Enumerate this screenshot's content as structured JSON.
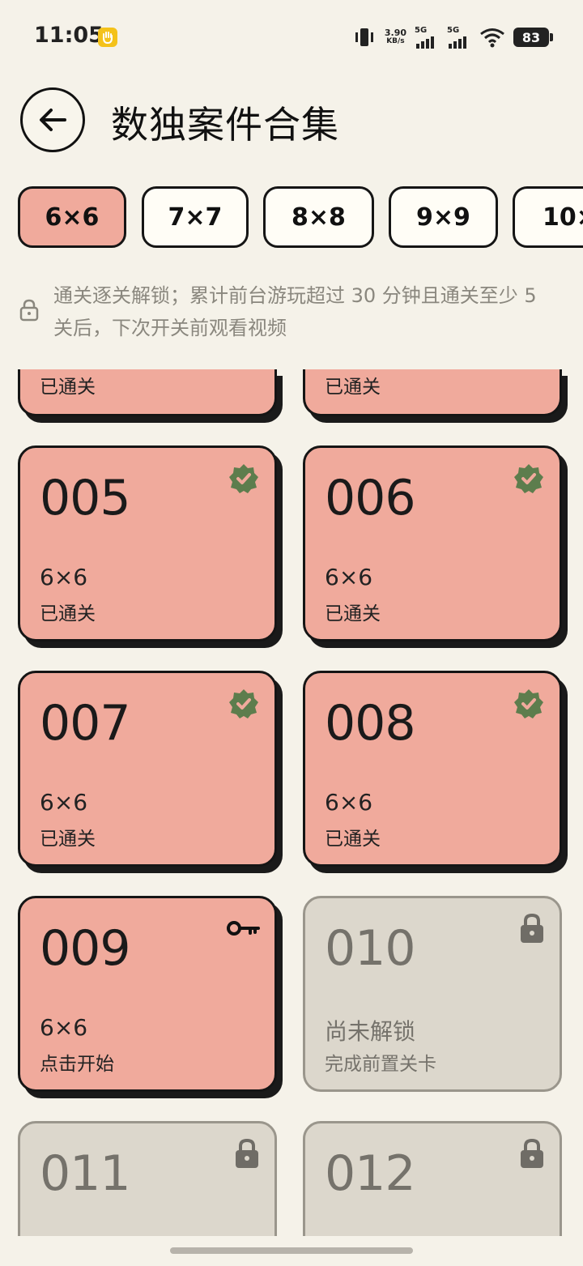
{
  "status_bar": {
    "time": "11:05",
    "speed_value": "3.90",
    "speed_unit": "KB/s",
    "net1_label": "5G",
    "net2_label": "5G",
    "battery": "83"
  },
  "header": {
    "title": "数独案件合集"
  },
  "tabs": [
    {
      "label": "6×6",
      "active": true
    },
    {
      "label": "7×7",
      "active": false
    },
    {
      "label": "8×8",
      "active": false
    },
    {
      "label": "9×9",
      "active": false
    },
    {
      "label": "10×",
      "active": false
    }
  ],
  "hint": {
    "text": "通关逐关解锁；累计前台游玩超过 30 分钟且通关至少 5 关后，下次开关前观看视频"
  },
  "partial_cards": [
    {
      "status": "已通关"
    },
    {
      "status": "已通关"
    }
  ],
  "cards": [
    {
      "number": "005",
      "size": "6×6",
      "status": "已通关",
      "state": "cleared",
      "badge": "verified-check-icon"
    },
    {
      "number": "006",
      "size": "6×6",
      "status": "已通关",
      "state": "cleared",
      "badge": "verified-check-icon"
    },
    {
      "number": "007",
      "size": "6×6",
      "status": "已通关",
      "state": "cleared",
      "badge": "verified-check-icon"
    },
    {
      "number": "008",
      "size": "6×6",
      "status": "已通关",
      "state": "cleared",
      "badge": "verified-check-icon"
    },
    {
      "number": "009",
      "size": "6×6",
      "status": "点击开始",
      "state": "available",
      "badge": "key-icon"
    },
    {
      "number": "010",
      "size": "尚未解锁",
      "status": "完成前置关卡",
      "state": "locked",
      "badge": "lock-icon"
    },
    {
      "number": "011",
      "size": "",
      "status": "",
      "state": "locked",
      "badge": "lock-icon"
    },
    {
      "number": "012",
      "size": "",
      "status": "",
      "state": "locked",
      "badge": "lock-icon"
    }
  ],
  "colors": {
    "background": "#f5f2e9",
    "card_active": "#f0aa9c",
    "card_locked": "#dcd7cc",
    "check_badge": "#5d7d4d"
  }
}
